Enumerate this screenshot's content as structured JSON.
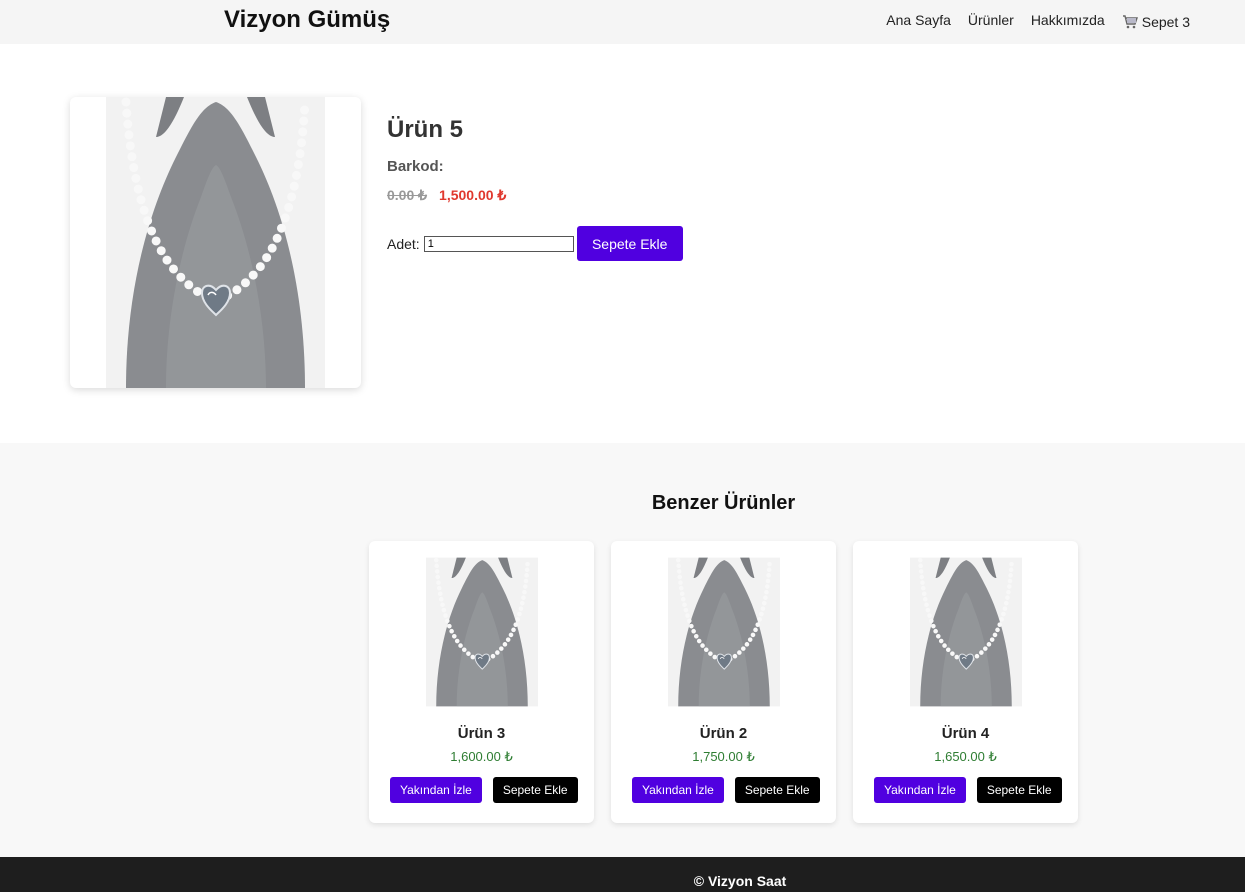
{
  "header": {
    "brand": "Vizyon Gümüş",
    "nav": [
      "Ana Sayfa",
      "Ürünler",
      "Hakkımızda"
    ],
    "cart_label": "Sepet 3"
  },
  "product": {
    "title": "Ürün 5",
    "barcode_label": "Barkod:",
    "old_price": "0.00 ₺",
    "new_price": "1,500.00 ₺",
    "qty_label": "Adet:",
    "qty_value": "1",
    "add_button": "Sepete Ekle"
  },
  "similar": {
    "title": "Benzer Ürünler",
    "items": [
      {
        "name": "Ürün 3",
        "price": "1,600.00 ₺",
        "watch_label": "Yakından İzle",
        "add_label": "Sepete Ekle"
      },
      {
        "name": "Ürün 2",
        "price": "1,750.00 ₺",
        "watch_label": "Yakından İzle",
        "add_label": "Sepete Ekle"
      },
      {
        "name": "Ürün 4",
        "price": "1,650.00 ₺",
        "watch_label": "Yakından İzle",
        "add_label": "Sepete Ekle"
      }
    ]
  },
  "footer": {
    "text": "© Vizyon Saat"
  },
  "colors": {
    "primary": "#5000e0",
    "sale_price": "#e0382e",
    "card_price": "#2e7d32",
    "footer_bg": "#1e1e1e"
  }
}
